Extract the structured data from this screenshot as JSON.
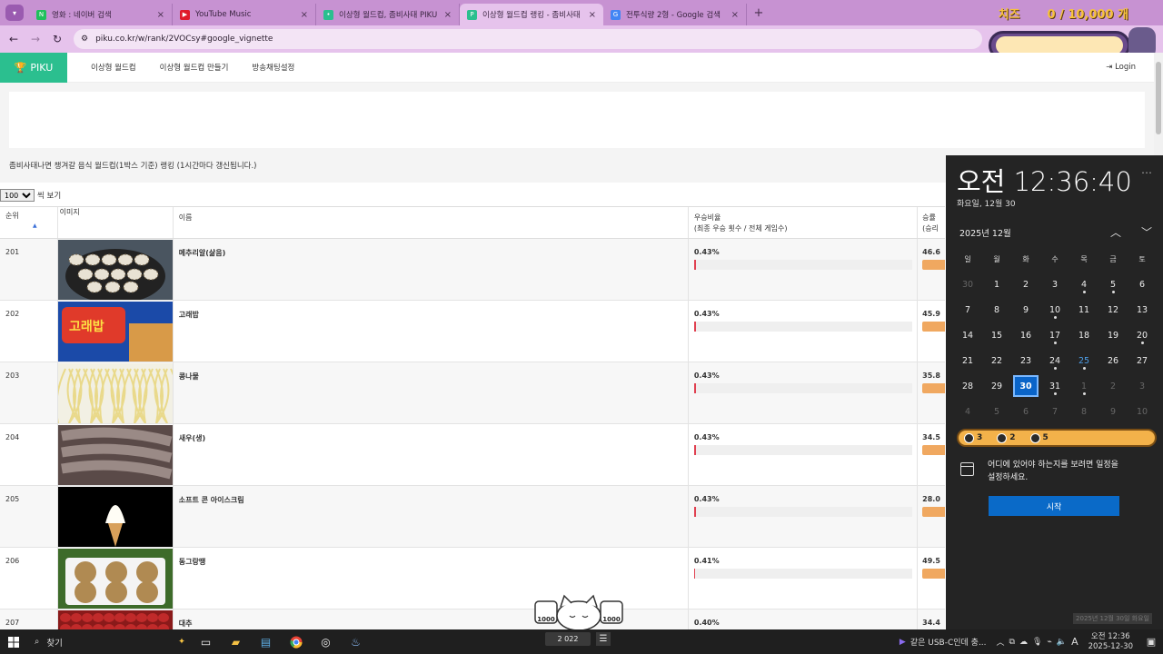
{
  "tabs": [
    {
      "label": "영화 : 네이버 검색",
      "color": "#20c05c",
      "glyph": "N"
    },
    {
      "label": "YouTube Music",
      "color": "#e01b2b",
      "glyph": "▶"
    },
    {
      "label": "이상형 월드컵, 좀비사태 PIKU",
      "color": "#2bbf8f",
      "glyph": "•"
    },
    {
      "label": "이상형 월드컵 랭킹 - 좀비사태",
      "color": "#2bbf8f",
      "glyph": "P",
      "active": true
    },
    {
      "label": "전투식량 2형 - Google 검색",
      "color": "#4285f4",
      "glyph": "G"
    }
  ],
  "address": {
    "url": "piku.co.kr/w/rank/2VOCsy#google_vignette"
  },
  "overlay": {
    "cheese_label": "치즈",
    "cheese_count": "0 / 10,000 개"
  },
  "site": {
    "logo": "PIKU",
    "nav": [
      "이상형 월드컵",
      "이상형 월드컵 만들기",
      "방송채팅설정"
    ],
    "login": "Login"
  },
  "page": {
    "subtitle": "좀비사태나면 챙겨갈 음식 월드컵(1박스 기준) 랭킹 (1시간마다 갱신됩니다.)",
    "page_size": "100",
    "page_size_suffix": "씩 보기"
  },
  "table": {
    "headers": {
      "rank": "순위",
      "sort": "▲",
      "image": "이미지",
      "name": "이름",
      "win_ratio": "우승비율",
      "win_ratio_sub": "(최종 우승 횟수 / 전체 게임수)",
      "rate": "승률",
      "rate_sub": "(승리"
    },
    "rows": [
      {
        "rank": "201",
        "name": "메추리알(삶음)",
        "ratio": "0.43%",
        "ratio_value": 0.43,
        "rate": "46.6",
        "img": "eggs"
      },
      {
        "rank": "202",
        "name": "고래밥",
        "ratio": "0.43%",
        "ratio_value": 0.43,
        "rate": "45.9",
        "img": "snack"
      },
      {
        "rank": "203",
        "name": "콩나물",
        "ratio": "0.43%",
        "ratio_value": 0.43,
        "rate": "35.8",
        "img": "sprouts"
      },
      {
        "rank": "204",
        "name": "새우(생)",
        "ratio": "0.43%",
        "ratio_value": 0.43,
        "rate": "34.5",
        "img": "shrimp"
      },
      {
        "rank": "205",
        "name": "소프트 콘 아이스크림",
        "ratio": "0.43%",
        "ratio_value": 0.43,
        "rate": "28.0",
        "img": "icecream"
      },
      {
        "rank": "206",
        "name": "동그랑땡",
        "ratio": "0.41%",
        "ratio_value": 0.41,
        "rate": "49.5",
        "img": "pancake"
      },
      {
        "rank": "207",
        "name": "대추",
        "ratio": "0.40%",
        "ratio_value": 0.4,
        "rate": "34.4",
        "img": "jujube"
      }
    ]
  },
  "calendar": {
    "time": "오전 12:36:40",
    "date": "화요일, 12월 30",
    "month": "2025년 12월",
    "weekdays": [
      "일",
      "월",
      "화",
      "수",
      "목",
      "금",
      "토"
    ],
    "days": [
      {
        "d": "30",
        "dim": true
      },
      {
        "d": "1"
      },
      {
        "d": "2"
      },
      {
        "d": "3"
      },
      {
        "d": "4",
        "ev": true
      },
      {
        "d": "5",
        "ev": true
      },
      {
        "d": "6"
      },
      {
        "d": "7"
      },
      {
        "d": "8"
      },
      {
        "d": "9"
      },
      {
        "d": "10",
        "ev": true
      },
      {
        "d": "11"
      },
      {
        "d": "12"
      },
      {
        "d": "13"
      },
      {
        "d": "14"
      },
      {
        "d": "15"
      },
      {
        "d": "16"
      },
      {
        "d": "17",
        "ev": true
      },
      {
        "d": "18"
      },
      {
        "d": "19"
      },
      {
        "d": "20",
        "ev": true
      },
      {
        "d": "21"
      },
      {
        "d": "22"
      },
      {
        "d": "23"
      },
      {
        "d": "24",
        "ev": true
      },
      {
        "d": "25",
        "blue": true,
        "ev": true
      },
      {
        "d": "26"
      },
      {
        "d": "27"
      },
      {
        "d": "28"
      },
      {
        "d": "29"
      },
      {
        "d": "30",
        "today": true
      },
      {
        "d": "31",
        "ev": true
      },
      {
        "d": "1",
        "dim": true,
        "ev": true
      },
      {
        "d": "2",
        "dim": true
      },
      {
        "d": "3",
        "dim": true
      },
      {
        "d": "4",
        "dim": true
      },
      {
        "d": "5",
        "dim": true
      },
      {
        "d": "6",
        "dim": true
      },
      {
        "d": "7",
        "dim": true
      },
      {
        "d": "8",
        "dim": true
      },
      {
        "d": "9",
        "dim": true
      },
      {
        "d": "10",
        "dim": true
      }
    ],
    "badges": [
      {
        "n": "3"
      },
      {
        "n": "2"
      },
      {
        "n": "5"
      }
    ],
    "agenda_text": "어디에 있어야 하는지를 보려면 일정을 설정하세요.",
    "start_label": "시작",
    "tooltip": "2025년 12월 30일 화요일"
  },
  "streamer": {
    "left": "1000",
    "right": "1000"
  },
  "taskbar": {
    "search": "찾기",
    "task_label": "2 022",
    "notif_text": "같은 USB-C인데 충...",
    "ime": "A",
    "clock_time": "오전 12:36",
    "clock_date": "2025-12-30"
  }
}
